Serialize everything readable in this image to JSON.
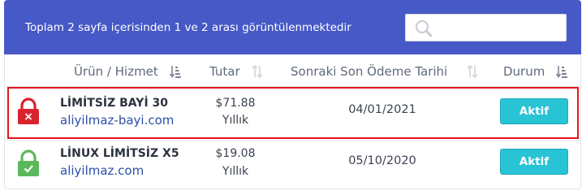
{
  "header": {
    "summary": "Toplam 2 sayfa içerisinden 1 ve 2 arası görüntülenmektedir",
    "search": {
      "value": "",
      "placeholder": "",
      "icon": "search-icon"
    }
  },
  "table": {
    "columns": [
      {
        "label": "Ürün / Hizmet",
        "sort_icon": "sort-amount-down-icon"
      },
      {
        "label": "Tutar",
        "sort_icon": "sort-icon"
      },
      {
        "label": "Sonraki Son Ödeme Tarihi",
        "sort_icon": "sort-icon"
      },
      {
        "label": "Durum",
        "sort_icon": "sort-amount-down-icon"
      }
    ],
    "rows": [
      {
        "status_icon": "lock-closed-red-icon",
        "product": "LİMİTSİZ BAYİ 30",
        "domain": "aliyilmaz-bayi.com",
        "amount": "$71.88",
        "cycle": "Yıllık",
        "next_due": "04/01/2021",
        "status": "Aktif",
        "highlighted": true
      },
      {
        "status_icon": "lock-check-green-icon",
        "product": "LİNUX LİMİTSİZ X5",
        "domain": "aliyilmaz.com",
        "amount": "$19.08",
        "cycle": "Yıllık",
        "next_due": "05/10/2020",
        "status": "Aktif",
        "highlighted": false
      }
    ]
  },
  "colors": {
    "header_bg": "#4759c7",
    "highlight_border": "#e1151c",
    "status_button": "#29c3d6",
    "lock_red": "#d9232e",
    "lock_green": "#5cb85c",
    "link": "#2d4ea8"
  }
}
